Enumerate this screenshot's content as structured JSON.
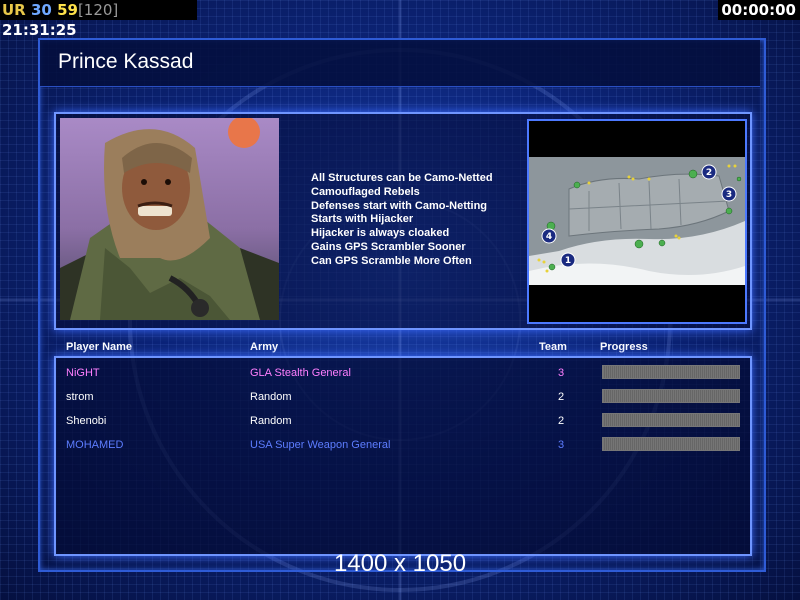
{
  "hud": {
    "ur": "UR",
    "fps": "30",
    "value59": "59",
    "bracket": "[120]",
    "clock": "21:31:25",
    "timer": "00:00:00"
  },
  "general": {
    "name": "Prince Kassad",
    "traits": [
      "All Structures can be Camo-Netted",
      "Camouflaged Rebels",
      "Defenses start with Camo-Netting",
      "Starts with Hijacker",
      "Hijacker is always cloaked",
      "Gains GPS Scrambler Sooner",
      "Can GPS Scramble More Often"
    ]
  },
  "minimap": {
    "start_positions": [
      "1",
      "2",
      "3",
      "4"
    ]
  },
  "table": {
    "headers": {
      "player": "Player Name",
      "army": "Army",
      "team": "Team",
      "progress": "Progress"
    },
    "rows": [
      {
        "name": "NiGHT",
        "army": "GLA Stealth General",
        "team": "3",
        "color": "#ff7fff",
        "progress": 0
      },
      {
        "name": "strom",
        "army": "Random",
        "team": "2",
        "color": "#ffffff",
        "progress": 0
      },
      {
        "name": "Shenobi",
        "army": "Random",
        "team": "2",
        "color": "#ffffff",
        "progress": 0
      },
      {
        "name": "MOHAMED",
        "army": "USA Super Weapon General",
        "team": "3",
        "color": "#5d7dff",
        "progress": 0
      }
    ]
  },
  "resolution": "1400 x 1050"
}
